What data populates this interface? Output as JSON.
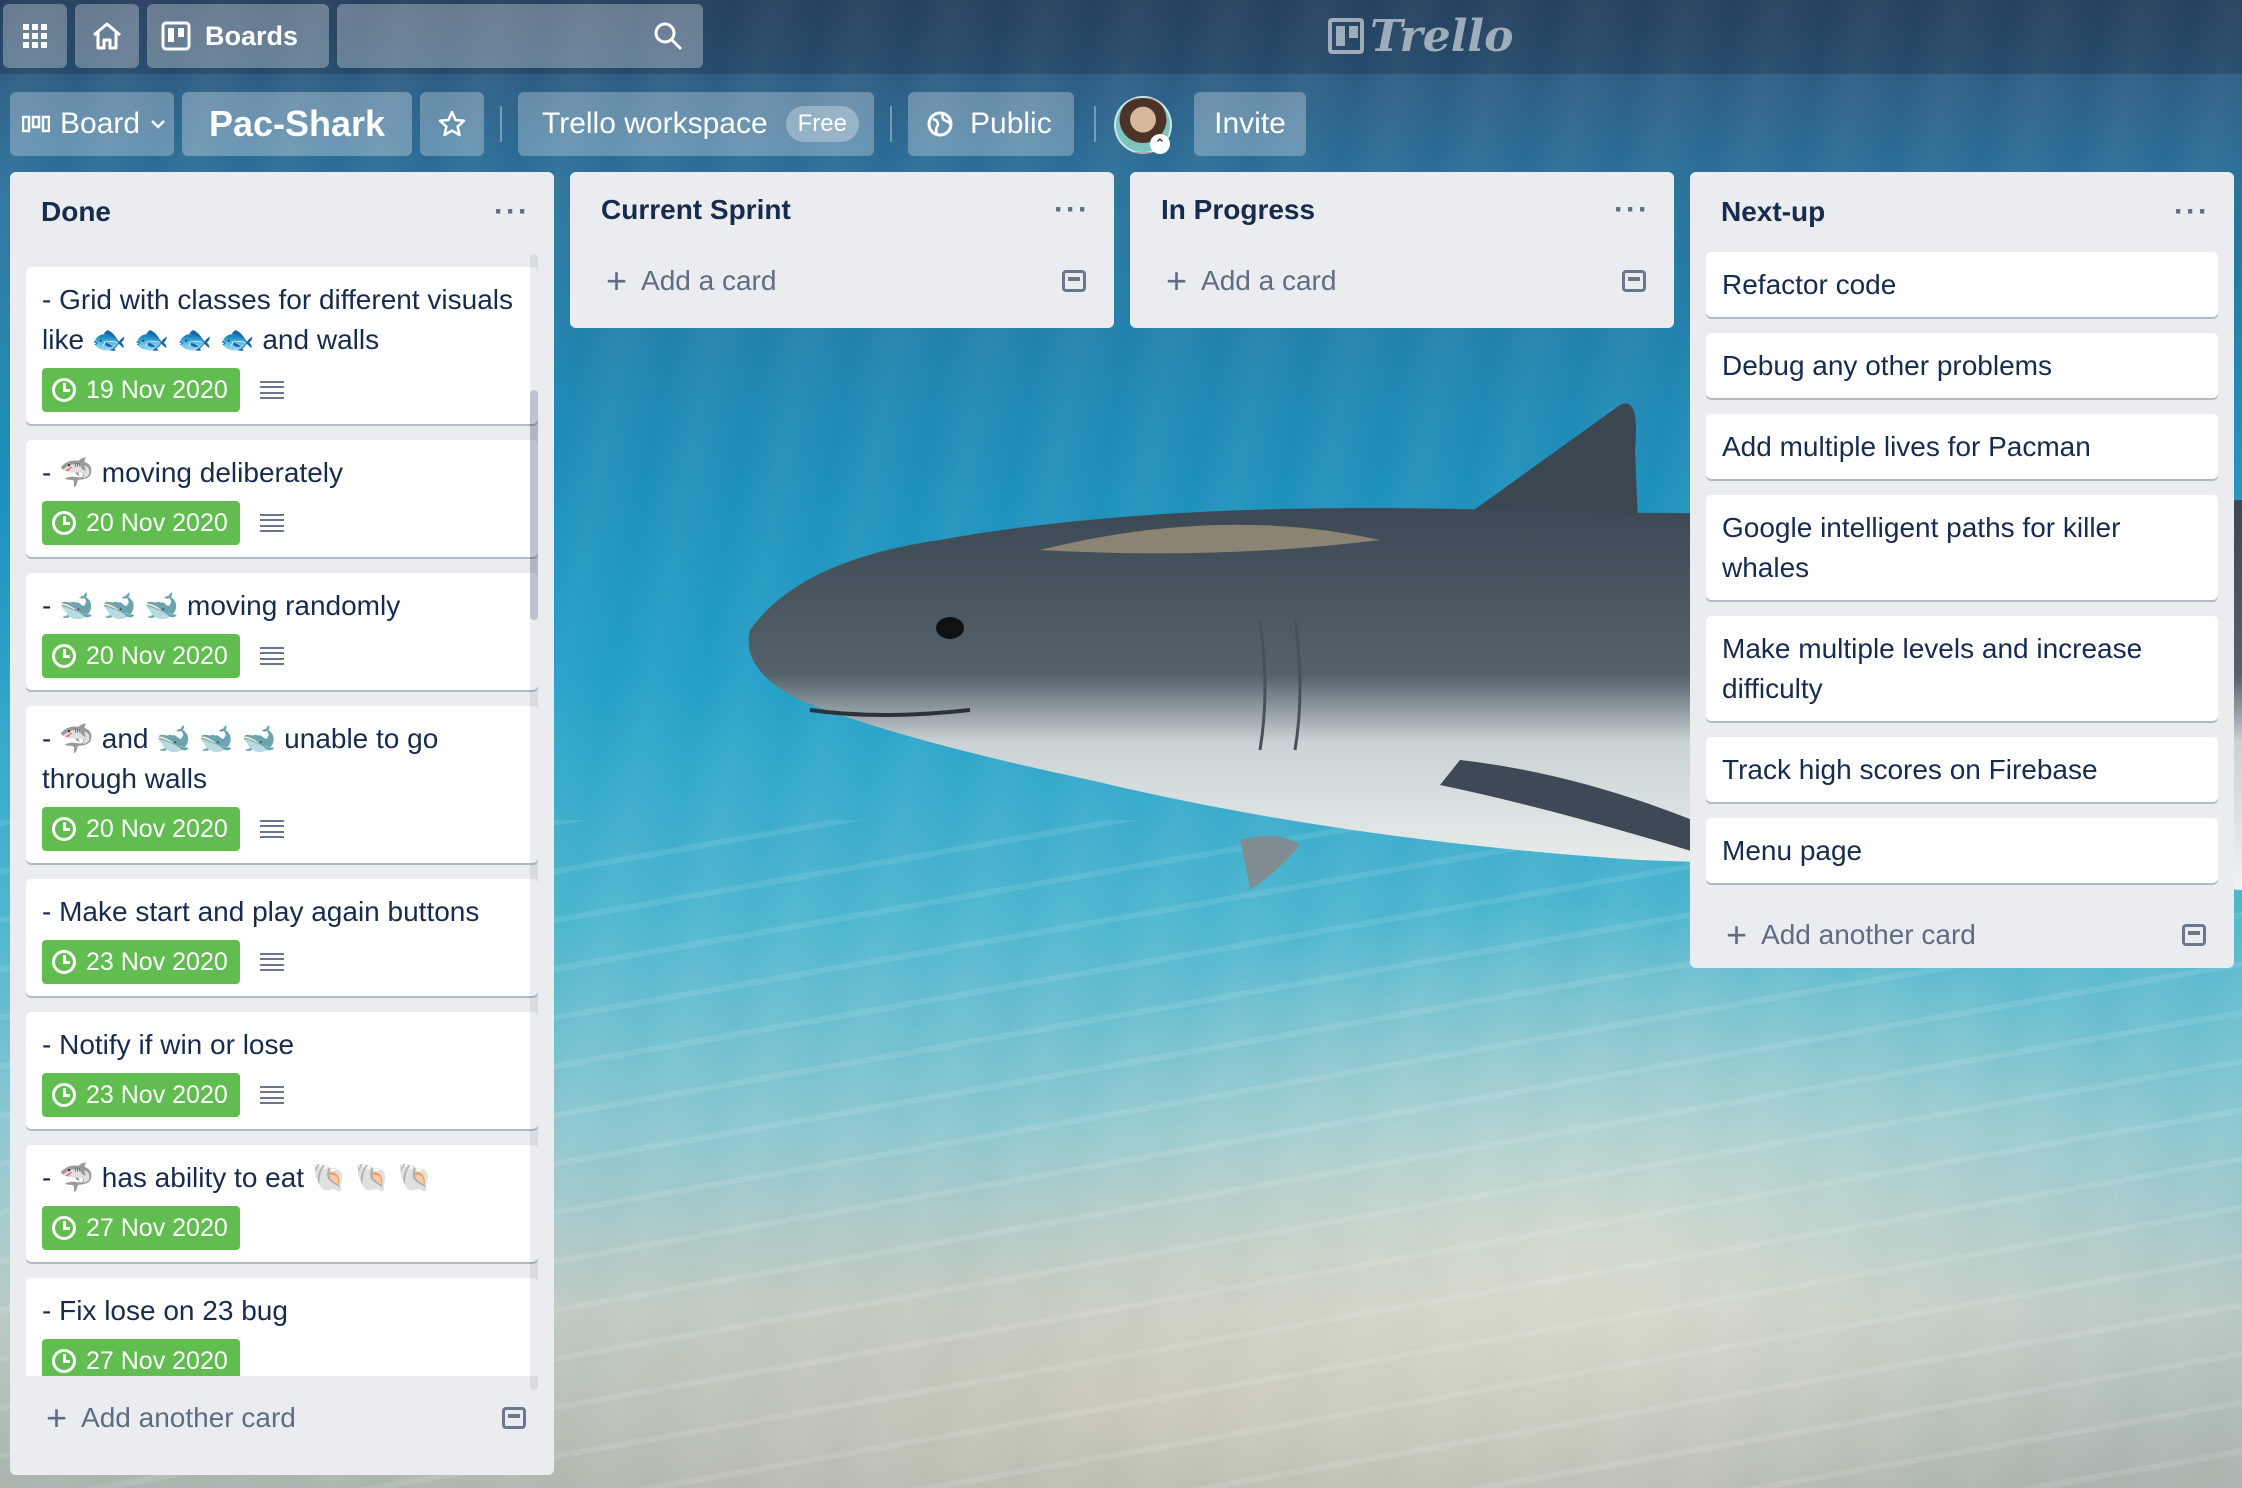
{
  "topbar": {
    "apps_icon": "grid-icon",
    "home_icon": "home-icon",
    "boards_label": "Boards",
    "search_icon": "search-icon",
    "logo_text": "Trello"
  },
  "board_header": {
    "view_label": "Board",
    "title": "Pac-Shark",
    "workspace_label": "Trello workspace",
    "workspace_badge": "Free",
    "visibility_label": "Public",
    "invite_label": "Invite"
  },
  "lists": [
    {
      "title": "Done",
      "cards": [
        {
          "text": "- Grid with classes for different visuals like 🐟 🐟 🐟 🐟 and walls",
          "due": "19 Nov 2020",
          "has_description": true
        },
        {
          "text": "- 🦈 moving deliberately",
          "due": "20 Nov 2020",
          "has_description": true
        },
        {
          "text": "- 🐋 🐋 🐋 moving randomly",
          "due": "20 Nov 2020",
          "has_description": true
        },
        {
          "text": "- 🦈 and 🐋 🐋 🐋 unable to go through walls",
          "due": "20 Nov 2020",
          "has_description": true
        },
        {
          "text": "- Make start and play again buttons",
          "due": "23 Nov 2020",
          "has_description": true
        },
        {
          "text": "- Notify if win or lose",
          "due": "23 Nov 2020",
          "has_description": true
        },
        {
          "text": "- 🦈 has ability to eat 🐚 🐚 🐚",
          "due": "27 Nov 2020",
          "has_description": false
        },
        {
          "text": "- Fix lose on 23 bug",
          "due": "27 Nov 2020",
          "has_description": false
        }
      ],
      "add_label": "Add another card"
    },
    {
      "title": "Current Sprint",
      "cards": [],
      "add_label": "Add a card"
    },
    {
      "title": "In Progress",
      "cards": [],
      "add_label": "Add a card"
    },
    {
      "title": "Next-up",
      "cards": [
        {
          "text": "Refactor code"
        },
        {
          "text": "Debug any other problems"
        },
        {
          "text": "Add multiple lives for Pacman"
        },
        {
          "text": "Google intelligent paths for killer whales"
        },
        {
          "text": "Make multiple levels and increase difficulty"
        },
        {
          "text": "Track high scores on Firebase"
        },
        {
          "text": "Menu page"
        }
      ],
      "add_label": "Add another card"
    }
  ],
  "colors": {
    "due_complete": "#61bd4f",
    "list_bg": "#ebecf0",
    "text": "#172b4d"
  }
}
